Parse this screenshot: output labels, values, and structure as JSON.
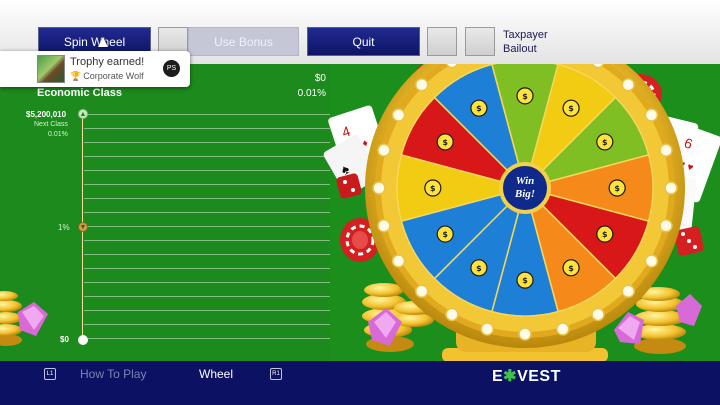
{
  "toolbar": {
    "spin_label": "Spin Wheel",
    "bonus_label": "Use Bonus",
    "quit_label": "Quit",
    "taxpayer_line1": "Taxpayer",
    "taxpayer_line2": "Bailout"
  },
  "trophy": {
    "title": "Trophy earned!",
    "name": "Corporate Wolf",
    "platform_icon": "PS"
  },
  "economy": {
    "class_label": "Economic Class",
    "money": "$0",
    "money_pct": "0.01%",
    "next_value": "$5,200,010",
    "next_label": "Next Class",
    "next_pct": "0.01%",
    "mid_label": "1%",
    "bottom_label": "$0"
  },
  "wheel": {
    "center_line1": "Win",
    "center_line2": "Big!",
    "segments": [
      {
        "color": "#7fbf23",
        "icon": "money-bag-icon"
      },
      {
        "color": "#f2cc12",
        "icon": "gold-bars-icon"
      },
      {
        "color": "#7fbf23",
        "icon": "money-bag-icon"
      },
      {
        "color": "#f5891a",
        "icon": "house-icon"
      },
      {
        "color": "#d81818",
        "icon": "stock-chart-icon"
      },
      {
        "color": "#f5891a",
        "icon": "coin-icon"
      },
      {
        "color": "#1e7fd6",
        "icon": "house-icon"
      },
      {
        "color": "#1e7fd6",
        "icon": "computer-network-icon"
      },
      {
        "color": "#1e7fd6",
        "icon": "coin-icon"
      },
      {
        "color": "#f2cc12",
        "icon": "gold-bars-icon"
      },
      {
        "color": "#d81818",
        "icon": "stock-chart-icon"
      },
      {
        "color": "#1e7fd6",
        "icon": "computer-network-icon"
      }
    ]
  },
  "bottom": {
    "l1": "L1",
    "howto": "How To Play",
    "wheel": "Wheel",
    "r1": "R1",
    "logo_left": "E",
    "logo_star": "✱",
    "logo_right": "VEST"
  },
  "colors": {
    "background": "#1d8a1d",
    "bar_blue": "#0c1164",
    "button_blue": "#1a2385",
    "gold": "#f2c230"
  }
}
